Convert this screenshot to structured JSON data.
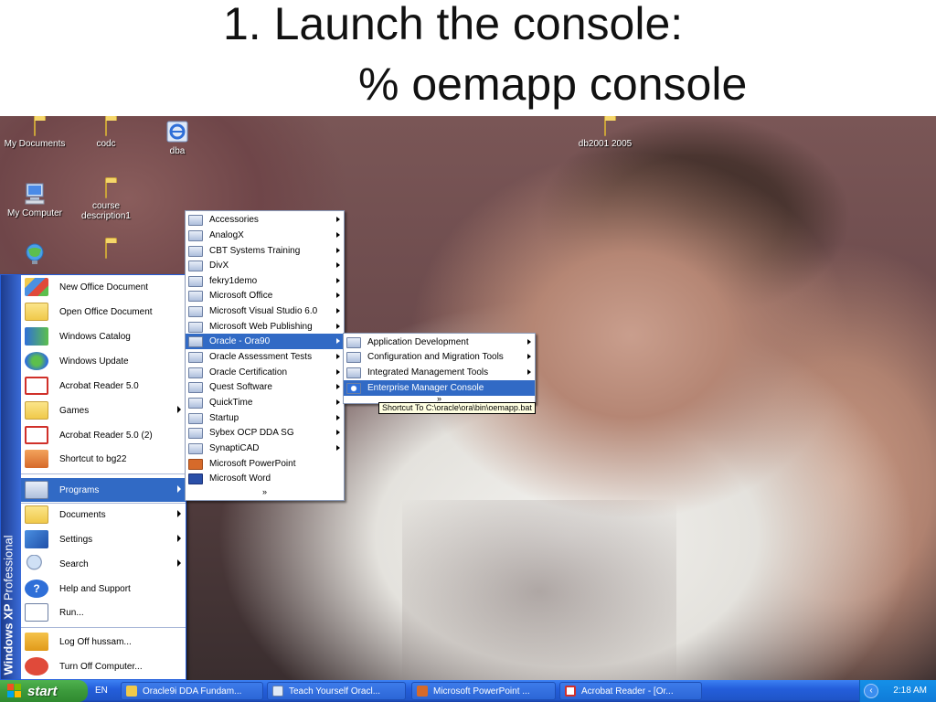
{
  "slide": {
    "title_line1": "1. Launch the console:",
    "title_line2": "% oemapp console"
  },
  "desktop_icons": [
    {
      "label": "My Documents"
    },
    {
      "label": "codc"
    },
    {
      "label": "dba"
    },
    {
      "label": "db2001 2005"
    },
    {
      "label": "My Computer"
    },
    {
      "label": "course description1"
    },
    {
      "label": ""
    },
    {
      "label": ""
    }
  ],
  "start_menu": {
    "brand": "Windows XP",
    "edition": "Professional",
    "items": [
      {
        "label": "New Office Document"
      },
      {
        "label": "Open Office Document"
      },
      {
        "label": "Windows Catalog"
      },
      {
        "label": "Windows Update"
      },
      {
        "label": "Acrobat Reader 5.0"
      },
      {
        "label": "Games"
      },
      {
        "label": "Acrobat Reader 5.0 (2)"
      },
      {
        "label": "Shortcut to bg22"
      },
      {
        "label": "Programs"
      },
      {
        "label": "Documents"
      },
      {
        "label": "Settings"
      },
      {
        "label": "Search"
      },
      {
        "label": "Help and Support"
      },
      {
        "label": "Run..."
      },
      {
        "label": "Log Off hussam..."
      },
      {
        "label": "Turn Off Computer..."
      }
    ]
  },
  "programs_menu": {
    "items": [
      {
        "label": "Accessories"
      },
      {
        "label": "AnalogX"
      },
      {
        "label": "CBT Systems Training"
      },
      {
        "label": "DivX"
      },
      {
        "label": "fekry1demo"
      },
      {
        "label": "Microsoft Office"
      },
      {
        "label": "Microsoft Visual Studio 6.0"
      },
      {
        "label": "Microsoft Web Publishing"
      },
      {
        "label": "Oracle - Ora90"
      },
      {
        "label": "Oracle Assessment Tests"
      },
      {
        "label": "Oracle Certification"
      },
      {
        "label": "Quest Software"
      },
      {
        "label": "QuickTime"
      },
      {
        "label": "Startup"
      },
      {
        "label": "Sybex OCP DDA SG"
      },
      {
        "label": "SynaptiCAD"
      },
      {
        "label": "Microsoft PowerPoint"
      },
      {
        "label": "Microsoft Word"
      }
    ],
    "more_chevron": "»"
  },
  "oracle_menu": {
    "items": [
      {
        "label": "Application Development"
      },
      {
        "label": "Configuration and Migration Tools"
      },
      {
        "label": "Integrated Management Tools"
      },
      {
        "label": "Enterprise Manager Console"
      }
    ],
    "more_chevron": "»"
  },
  "tooltip": "Shortcut To C:\\oracle\\ora\\bin\\oemapp.bat",
  "taskbar": {
    "start_label": "start",
    "language": "EN",
    "buttons": [
      {
        "label": "Oracle9i DDA Fundam..."
      },
      {
        "label": "Teach Yourself Oracl..."
      },
      {
        "label": "Microsoft PowerPoint ..."
      },
      {
        "label": "Acrobat Reader - [Or..."
      }
    ],
    "tray_chevron": "‹",
    "clock": "2:18 AM"
  },
  "colors": {
    "highlight": "#316ac5",
    "taskbar": "#245edb",
    "start_button": "#3c9a3c",
    "tray": "#0f7bd8"
  }
}
